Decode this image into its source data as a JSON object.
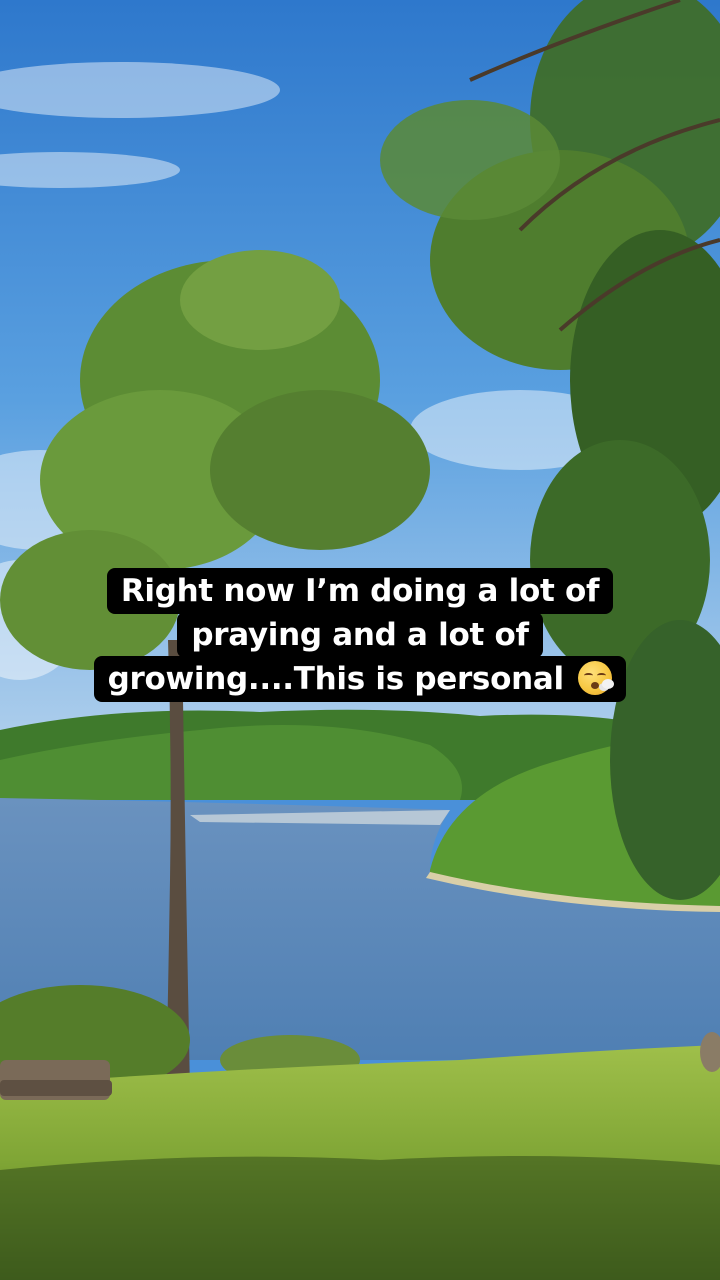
{
  "caption": {
    "line1": "Right now I’m doing a lot of",
    "line2": "praying and a lot of",
    "line3": "growing....This is personal",
    "emoji_icon": "face-exhaling-icon"
  },
  "colors": {
    "sky": "#3f8bd8",
    "water": "#5b86b5",
    "grass": "#86a83a",
    "caption_bg": "#000000",
    "caption_text": "#ffffff"
  }
}
